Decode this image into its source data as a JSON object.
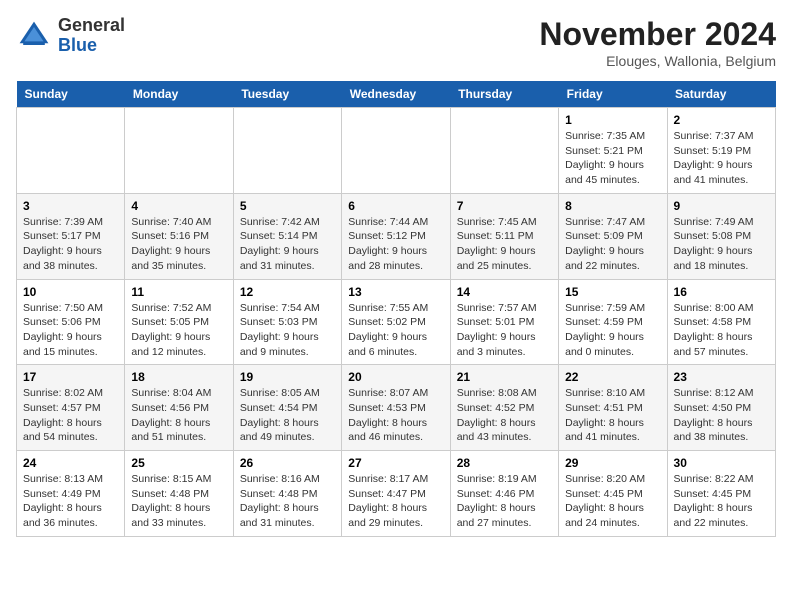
{
  "logo": {
    "line1": "General",
    "line2": "Blue"
  },
  "title": "November 2024",
  "location": "Elouges, Wallonia, Belgium",
  "weekdays": [
    "Sunday",
    "Monday",
    "Tuesday",
    "Wednesday",
    "Thursday",
    "Friday",
    "Saturday"
  ],
  "weeks": [
    [
      {
        "day": "",
        "info": ""
      },
      {
        "day": "",
        "info": ""
      },
      {
        "day": "",
        "info": ""
      },
      {
        "day": "",
        "info": ""
      },
      {
        "day": "",
        "info": ""
      },
      {
        "day": "1",
        "info": "Sunrise: 7:35 AM\nSunset: 5:21 PM\nDaylight: 9 hours and 45 minutes."
      },
      {
        "day": "2",
        "info": "Sunrise: 7:37 AM\nSunset: 5:19 PM\nDaylight: 9 hours and 41 minutes."
      }
    ],
    [
      {
        "day": "3",
        "info": "Sunrise: 7:39 AM\nSunset: 5:17 PM\nDaylight: 9 hours and 38 minutes."
      },
      {
        "day": "4",
        "info": "Sunrise: 7:40 AM\nSunset: 5:16 PM\nDaylight: 9 hours and 35 minutes."
      },
      {
        "day": "5",
        "info": "Sunrise: 7:42 AM\nSunset: 5:14 PM\nDaylight: 9 hours and 31 minutes."
      },
      {
        "day": "6",
        "info": "Sunrise: 7:44 AM\nSunset: 5:12 PM\nDaylight: 9 hours and 28 minutes."
      },
      {
        "day": "7",
        "info": "Sunrise: 7:45 AM\nSunset: 5:11 PM\nDaylight: 9 hours and 25 minutes."
      },
      {
        "day": "8",
        "info": "Sunrise: 7:47 AM\nSunset: 5:09 PM\nDaylight: 9 hours and 22 minutes."
      },
      {
        "day": "9",
        "info": "Sunrise: 7:49 AM\nSunset: 5:08 PM\nDaylight: 9 hours and 18 minutes."
      }
    ],
    [
      {
        "day": "10",
        "info": "Sunrise: 7:50 AM\nSunset: 5:06 PM\nDaylight: 9 hours and 15 minutes."
      },
      {
        "day": "11",
        "info": "Sunrise: 7:52 AM\nSunset: 5:05 PM\nDaylight: 9 hours and 12 minutes."
      },
      {
        "day": "12",
        "info": "Sunrise: 7:54 AM\nSunset: 5:03 PM\nDaylight: 9 hours and 9 minutes."
      },
      {
        "day": "13",
        "info": "Sunrise: 7:55 AM\nSunset: 5:02 PM\nDaylight: 9 hours and 6 minutes."
      },
      {
        "day": "14",
        "info": "Sunrise: 7:57 AM\nSunset: 5:01 PM\nDaylight: 9 hours and 3 minutes."
      },
      {
        "day": "15",
        "info": "Sunrise: 7:59 AM\nSunset: 4:59 PM\nDaylight: 9 hours and 0 minutes."
      },
      {
        "day": "16",
        "info": "Sunrise: 8:00 AM\nSunset: 4:58 PM\nDaylight: 8 hours and 57 minutes."
      }
    ],
    [
      {
        "day": "17",
        "info": "Sunrise: 8:02 AM\nSunset: 4:57 PM\nDaylight: 8 hours and 54 minutes."
      },
      {
        "day": "18",
        "info": "Sunrise: 8:04 AM\nSunset: 4:56 PM\nDaylight: 8 hours and 51 minutes."
      },
      {
        "day": "19",
        "info": "Sunrise: 8:05 AM\nSunset: 4:54 PM\nDaylight: 8 hours and 49 minutes."
      },
      {
        "day": "20",
        "info": "Sunrise: 8:07 AM\nSunset: 4:53 PM\nDaylight: 8 hours and 46 minutes."
      },
      {
        "day": "21",
        "info": "Sunrise: 8:08 AM\nSunset: 4:52 PM\nDaylight: 8 hours and 43 minutes."
      },
      {
        "day": "22",
        "info": "Sunrise: 8:10 AM\nSunset: 4:51 PM\nDaylight: 8 hours and 41 minutes."
      },
      {
        "day": "23",
        "info": "Sunrise: 8:12 AM\nSunset: 4:50 PM\nDaylight: 8 hours and 38 minutes."
      }
    ],
    [
      {
        "day": "24",
        "info": "Sunrise: 8:13 AM\nSunset: 4:49 PM\nDaylight: 8 hours and 36 minutes."
      },
      {
        "day": "25",
        "info": "Sunrise: 8:15 AM\nSunset: 4:48 PM\nDaylight: 8 hours and 33 minutes."
      },
      {
        "day": "26",
        "info": "Sunrise: 8:16 AM\nSunset: 4:48 PM\nDaylight: 8 hours and 31 minutes."
      },
      {
        "day": "27",
        "info": "Sunrise: 8:17 AM\nSunset: 4:47 PM\nDaylight: 8 hours and 29 minutes."
      },
      {
        "day": "28",
        "info": "Sunrise: 8:19 AM\nSunset: 4:46 PM\nDaylight: 8 hours and 27 minutes."
      },
      {
        "day": "29",
        "info": "Sunrise: 8:20 AM\nSunset: 4:45 PM\nDaylight: 8 hours and 24 minutes."
      },
      {
        "day": "30",
        "info": "Sunrise: 8:22 AM\nSunset: 4:45 PM\nDaylight: 8 hours and 22 minutes."
      }
    ]
  ]
}
